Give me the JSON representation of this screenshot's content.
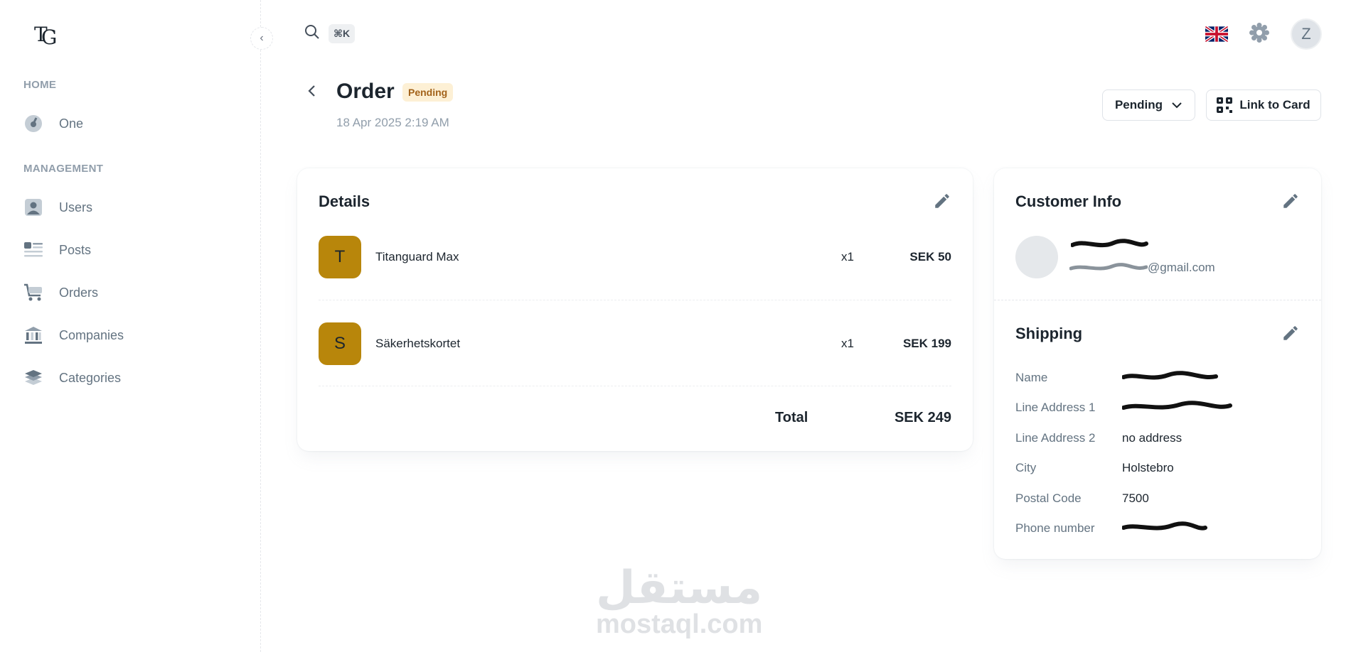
{
  "sidebar": {
    "logo": "TG",
    "sections": [
      {
        "heading": "HOME",
        "items": [
          {
            "label": "One",
            "icon": "dashboard-icon"
          }
        ]
      },
      {
        "heading": "MANAGEMENT",
        "items": [
          {
            "label": "Users",
            "icon": "user-icon"
          },
          {
            "label": "Posts",
            "icon": "posts-icon"
          },
          {
            "label": "Orders",
            "icon": "cart-icon"
          },
          {
            "label": "Companies",
            "icon": "bank-icon"
          },
          {
            "label": "Categories",
            "icon": "layers-icon"
          }
        ]
      }
    ]
  },
  "topbar": {
    "search_shortcut": "⌘K",
    "avatar_initial": "Z",
    "language": "en-GB"
  },
  "order": {
    "title": "Order",
    "status": "Pending",
    "date": "18 Apr 2025 2:19 AM",
    "status_select": "Pending",
    "link_card_label": "Link to Card"
  },
  "details": {
    "title": "Details",
    "items": [
      {
        "initial": "T",
        "name": "Titanguard Max",
        "qty": "x1",
        "price": "SEK 50"
      },
      {
        "initial": "S",
        "name": "Säkerhetskortet",
        "qty": "x1",
        "price": "SEK 199"
      }
    ],
    "total_label": "Total",
    "total_value": "SEK 249"
  },
  "customer": {
    "title": "Customer Info",
    "email_visible": "@gmail.com"
  },
  "shipping": {
    "title": "Shipping",
    "rows": [
      {
        "label": "Name",
        "value": ""
      },
      {
        "label": "Line Address 1",
        "value": ""
      },
      {
        "label": "Line Address 2",
        "value": "no address"
      },
      {
        "label": "City",
        "value": "Holstebro"
      },
      {
        "label": "Postal Code",
        "value": "7500"
      },
      {
        "label": "Phone number",
        "value": ""
      }
    ]
  },
  "watermark": {
    "arabic": "مستقل",
    "latin": "mostaql.com"
  },
  "colors": {
    "item_avatar": "#b8860b",
    "badge_bg": "#fdf0d5",
    "badge_text": "#a3631b"
  }
}
